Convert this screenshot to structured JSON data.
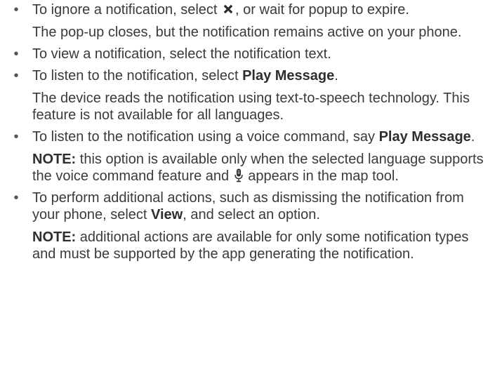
{
  "items": [
    {
      "line_a_before": "To ignore a notification, select ",
      "line_a_after": ", or wait for popup to expire.",
      "detail": "The pop-up closes, but the notification remains active on your phone.",
      "icon": "close-x-icon"
    },
    {
      "text": "To view a notification, select the notification text."
    },
    {
      "text_before": "To listen to the notification, select ",
      "bold": "Play Message",
      "text_after": ".",
      "detail": "The device reads the notification using text-to-speech technology. This feature is not available for all languages."
    },
    {
      "text_before": "To listen to the notification using a voice command, say ",
      "bold": "Play Message",
      "text_after": ".",
      "note_label": "NOTE:",
      "note_before": " this option is available only when the selected language supports the voice command feature and ",
      "note_after": " appears in the map tool.",
      "note_icon": "microphone-icon"
    },
    {
      "text_before": "To perform additional actions, such as dismissing the notification from your phone, select ",
      "bold": "View",
      "text_after": ", and select an option.",
      "note_label": "NOTE:",
      "note_text": " additional actions are available for only some notification types and must be supported by the app generating the notification."
    }
  ],
  "bullet_char": "•"
}
